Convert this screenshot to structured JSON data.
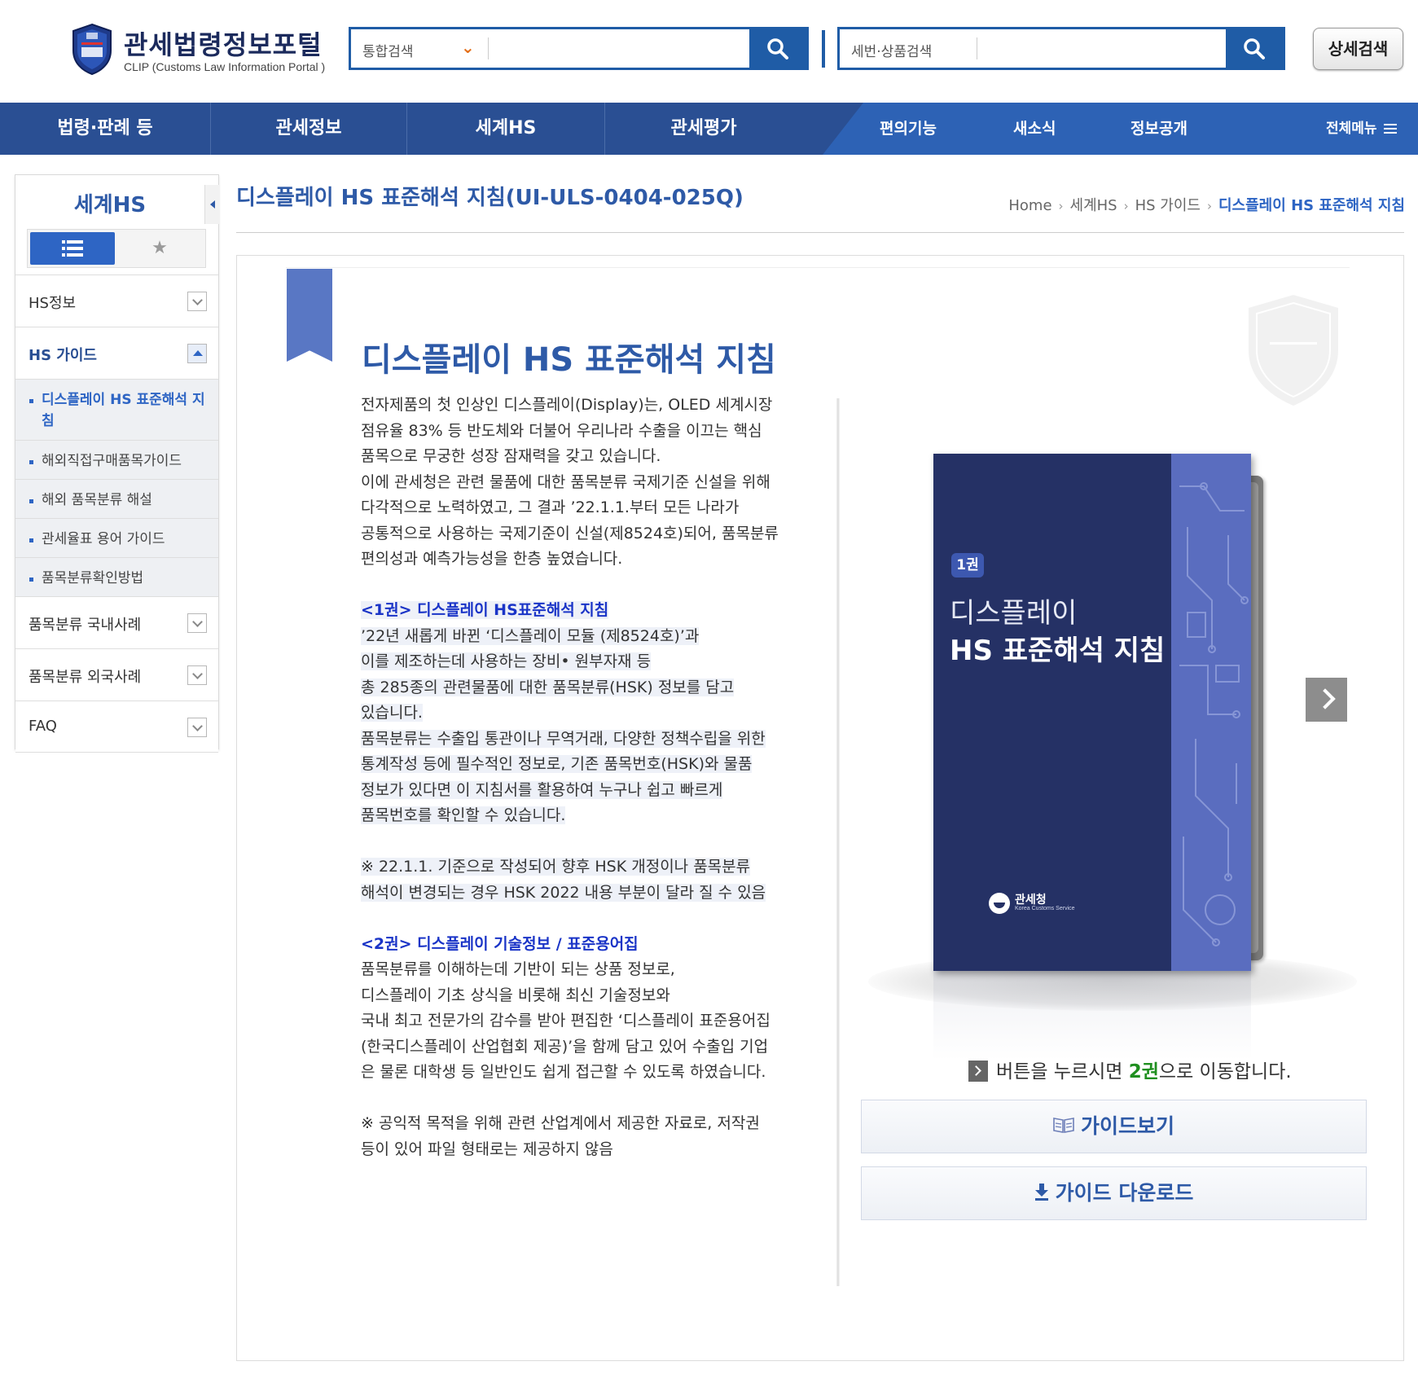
{
  "header": {
    "logo_title": "관세법령정보포털",
    "logo_sub": "CLIP (Customs Law Information Portal )",
    "search1": {
      "select": "통합검색",
      "placeholder": ""
    },
    "search2": {
      "select": "세번·상품검색",
      "placeholder": ""
    },
    "detail_search": "상세검색"
  },
  "gnb": {
    "main": [
      "법령·판례 등",
      "관세정보",
      "세계HS",
      "관세평가"
    ],
    "right": [
      "편의기능",
      "새소식",
      "정보공개"
    ],
    "all_menu": "전체메뉴"
  },
  "sidebar": {
    "title": "세계HS",
    "items": [
      {
        "label": "HS정보"
      },
      {
        "label": "HS 가이드"
      },
      {
        "label": "품목분류 국내사례"
      },
      {
        "label": "품목분류 외국사례"
      },
      {
        "label": "FAQ"
      }
    ],
    "sub_items": [
      "디스플레이 HS 표준해석 지침",
      "해외직접구매품목가이드",
      "해외 품목분류 해설",
      "관세율표 용어 가이드",
      "품목분류확인방법"
    ]
  },
  "page": {
    "title": "디스플레이 HS 표준해석 지침(UI-ULS-0404-025Q)",
    "breadcrumb": [
      "Home",
      "세계HS",
      "HS 가이드",
      "디스플레이 HS 표준해석 지침"
    ]
  },
  "content": {
    "heading": "디스플레이 HS 표준해석 지침",
    "intro": [
      " 전자제품의 첫 인상인 디스플레이(Display)는, OLED 세계시장",
      "점유율 83% 등 반도체와 더불어 우리나라 수출을 이끄는 핵심",
      "품목으로 무궁한 성장 잠재력을 갖고 있습니다.",
      "이에 관세청은 관련 물품에 대한 품목분류 국제기준 신설을 위해",
      "다각적으로 노력하였고, 그 결과 ’22.1.1.부터 모든 나라가",
      "공통적으로 사용하는 국제기준이 신설(제8524호)되어, 품목분류",
      "편의성과 예측가능성을 한층 높였습니다."
    ],
    "vol1_title": "<1권> 디스플레이 HS표준해석 지침",
    "vol1_lines": [
      "’22년 새롭게 바뀐 ‘디스플레이 모듈 (제8524호)’과",
      "이를 제조하는데 사용하는 장비• 원부자재 등",
      "총 285종의 관련물품에 대한 품목분류(HSK) 정보를 담고",
      "있습니다.",
      "품목분류는 수출입 통관이나 무역거래, 다양한 정책수립을 위한",
      "통계작성 등에 필수적인 정보로, 기존 품목번호(HSK)와 물품",
      "정보가 있다면 이 지침서를 활용하여 누구나 쉽고 빠르게",
      "품목번호를 확인할 수 있습니다."
    ],
    "vol1_note": [
      "※ 22.1.1. 기준으로 작성되어 향후 HSK 개정이나 품목분류",
      "해석이 변경되는 경우 HSK 2022 내용 부분이 달라 질 수 있음"
    ],
    "vol2_title": "<2권> 디스플레이 기술정보 / 표준용어집",
    "vol2_lines": [
      "품목분류를 이해하는데 기반이 되는 상품 정보로,",
      "디스플레이 기초 상식을 비롯해 최신 기술정보와",
      "국내 최고 전문가의 감수를 받아 편집한 ‘디스플레이 표준용어집",
      "(한국디스플레이 산업협회 제공)’을 함께 담고 있어 수출입 기업",
      "은 물론 대학생 등 일반인도 쉽게 접근할 수 있도록 하였습니다."
    ],
    "vol2_note": [
      "※ 공익적 목적을 위해 관련 산업계에서 제공한 자료로, 저작권",
      "등이 있어 파일 형태로는 제공하지 않음"
    ]
  },
  "book": {
    "badge": "1권",
    "title_line1": "디스플레이",
    "title_line2": "HS 표준해석 지침",
    "publisher": "관세청",
    "publisher_en": "Korea Customs Service",
    "watermark": "관세청 KOREA CUSTOMS SERVICE"
  },
  "actions": {
    "move_note_pre": "버튼을 누르시면 ",
    "move_note_vol": "2권",
    "move_note_post": "으로 이동합니다.",
    "view_guide": "가이드보기",
    "download_guide": "가이드 다운로드"
  },
  "colors": {
    "primary": "#2e5aa7",
    "nav_dark": "#2a4f93",
    "accent_orange": "#e46f19",
    "section_blue": "#1a34c7",
    "highlight_green": "#1f8f1f"
  }
}
